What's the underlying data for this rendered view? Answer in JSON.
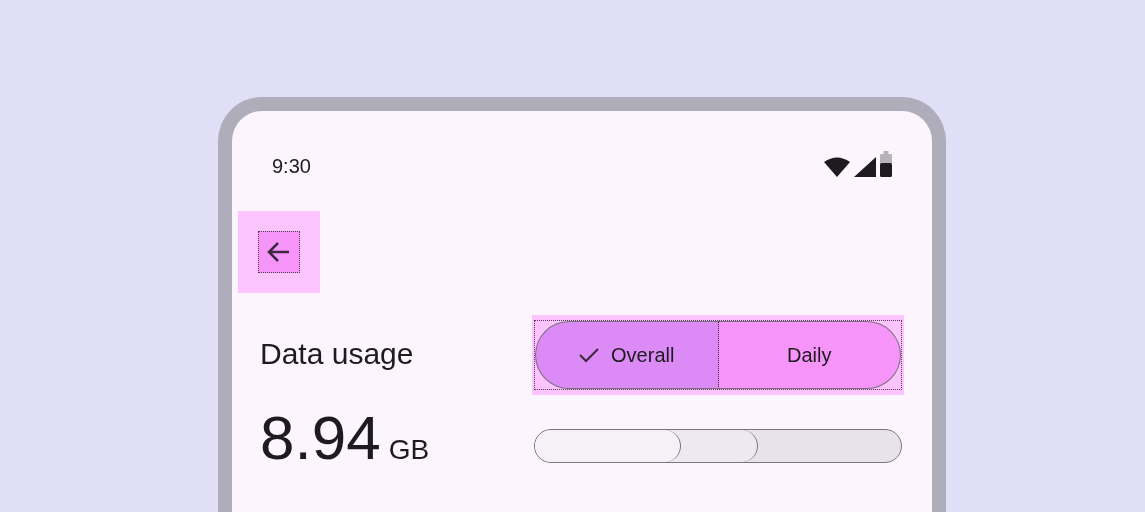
{
  "status_bar": {
    "time": "9:30"
  },
  "title": "Data usage",
  "segments": [
    {
      "label": "Overall",
      "selected": true
    },
    {
      "label": "Daily",
      "selected": false
    }
  ],
  "usage": {
    "amount": "8.94",
    "unit": "GB"
  },
  "usage_bar": {
    "segments": [
      {
        "level": 0.4
      },
      {
        "level": 0.61
      }
    ]
  }
}
